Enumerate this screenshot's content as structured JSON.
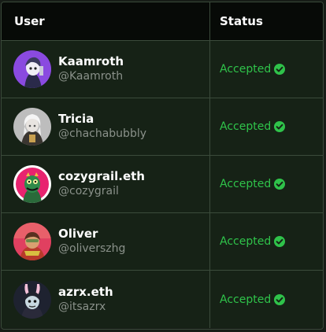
{
  "table": {
    "columns": {
      "user": "User",
      "status": "Status"
    },
    "rows": [
      {
        "name": "Kaamroth",
        "handle": "@Kaamroth",
        "status": "Accepted",
        "avatar": "purple-character-avatar"
      },
      {
        "name": "Tricia",
        "handle": "@chachabubbly",
        "status": "Accepted",
        "avatar": "white-hair-character-avatar"
      },
      {
        "name": "cozygrail.eth",
        "handle": "@cozygrail",
        "status": "Accepted",
        "avatar": "green-monster-avatar"
      },
      {
        "name": "Oliver",
        "handle": "@oliverszhg",
        "status": "Accepted",
        "avatar": "red-armored-character-avatar"
      },
      {
        "name": "azrx.eth",
        "handle": "@itsazrx",
        "status": "Accepted",
        "avatar": "bunny-ears-character-avatar"
      }
    ]
  },
  "colors": {
    "status_accepted": "#2fc34a",
    "row_background": "#162216",
    "header_background": "#070a07"
  }
}
